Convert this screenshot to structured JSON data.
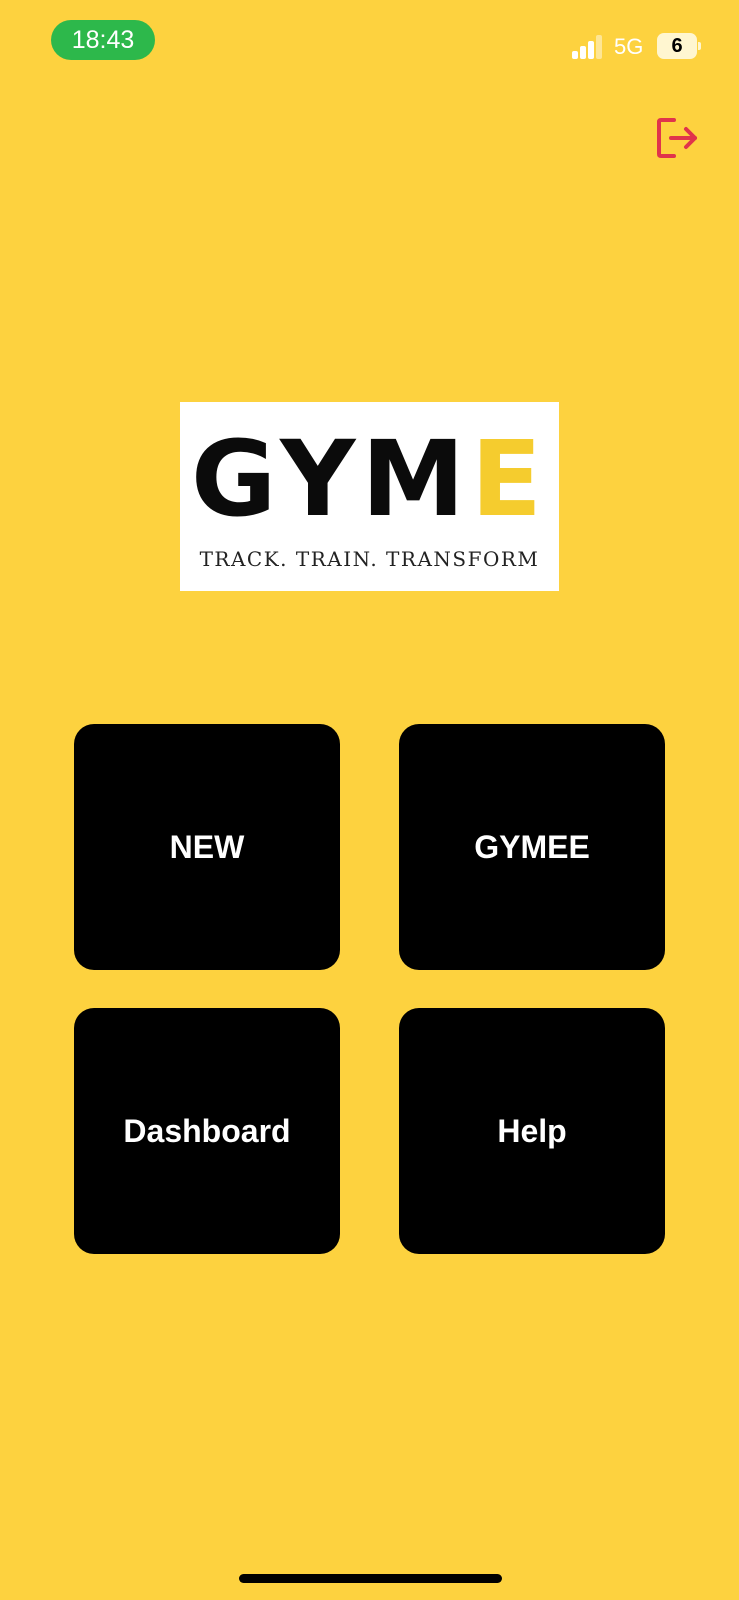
{
  "status_bar": {
    "time": "18:43",
    "network": "5G",
    "battery_level": "6",
    "signal_icon": "cellular-signal-icon",
    "battery_icon": "battery-icon"
  },
  "header": {
    "logout_icon": "logout-icon",
    "logout_color": "#E0344B"
  },
  "logo": {
    "brand_main": "GYM",
    "brand_accent": "E",
    "tagline": "TRACK. TRAIN. TRANSFORM"
  },
  "menu": {
    "new_label": "NEW",
    "gymee_label": "GYMEE",
    "dashboard_label": "Dashboard",
    "help_label": "Help"
  },
  "colors": {
    "background": "#FDD23F",
    "tile": "#000000",
    "tile_text": "#FFFFFF",
    "time_pill": "#2DB84B",
    "brand_accent": "#F5CC2E"
  }
}
